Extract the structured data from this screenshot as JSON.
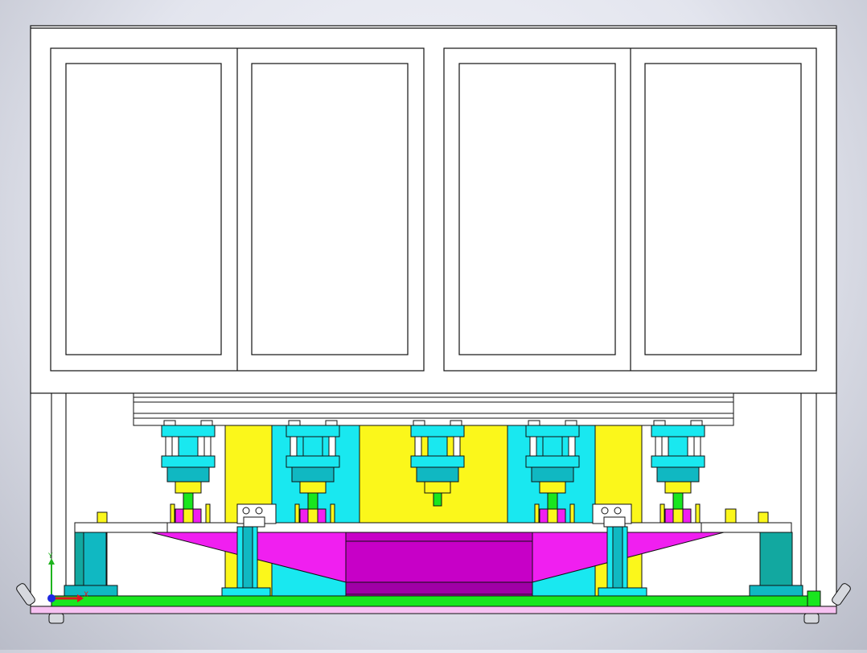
{
  "viewport": {
    "description_name": "cad-front-view",
    "background_top": "#f4f5fb",
    "background_bottom": "#b9bcc8"
  },
  "colors": {
    "cyan": "#19e8f0",
    "cyan_dark": "#10b8c2",
    "teal": "#12a8a0",
    "yellow": "#fbf71b",
    "magenta": "#f01ff0",
    "purple": "#c700c7",
    "purple_dark": "#a000a6",
    "green": "#19e61e",
    "pink": "#f7c2f2",
    "white": "#ffffff",
    "gray": "#c8cad2",
    "outline": "#111111"
  },
  "triad": {
    "x_label": "X",
    "y_label": "Y",
    "x_color": "#e0141e",
    "y_color": "#1eb41e",
    "z_color": "#1e28e0"
  }
}
